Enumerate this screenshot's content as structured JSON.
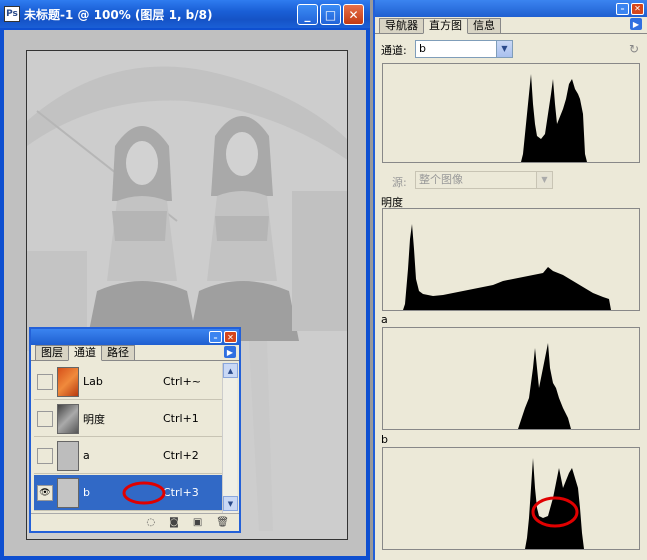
{
  "doc_window": {
    "title": "未标题-1 @ 100% (图层 1, b/8)"
  },
  "channels_panel": {
    "tabs": [
      "图层",
      "通道",
      "路径"
    ],
    "active_tab": "通道",
    "channels": [
      {
        "name": "Lab",
        "shortcut": "Ctrl+~",
        "visible": false
      },
      {
        "name": "明度",
        "shortcut": "Ctrl+1",
        "visible": false
      },
      {
        "name": "a",
        "shortcut": "Ctrl+2",
        "visible": false
      },
      {
        "name": "b",
        "shortcut": "Ctrl+3",
        "visible": true,
        "selected": true
      }
    ]
  },
  "histogram_panel": {
    "tabs": [
      "导航器",
      "直方图",
      "信息"
    ],
    "active_tab": "直方图",
    "channel_label": "通道:",
    "channel_value": "b",
    "source_label": "源:",
    "source_value": "整个图像",
    "sections": [
      "明度",
      "a",
      "b"
    ]
  },
  "colors": {
    "xp_blue": "#1a5fd6",
    "selection": "#3169c6",
    "annotation_red": "#e00000"
  }
}
